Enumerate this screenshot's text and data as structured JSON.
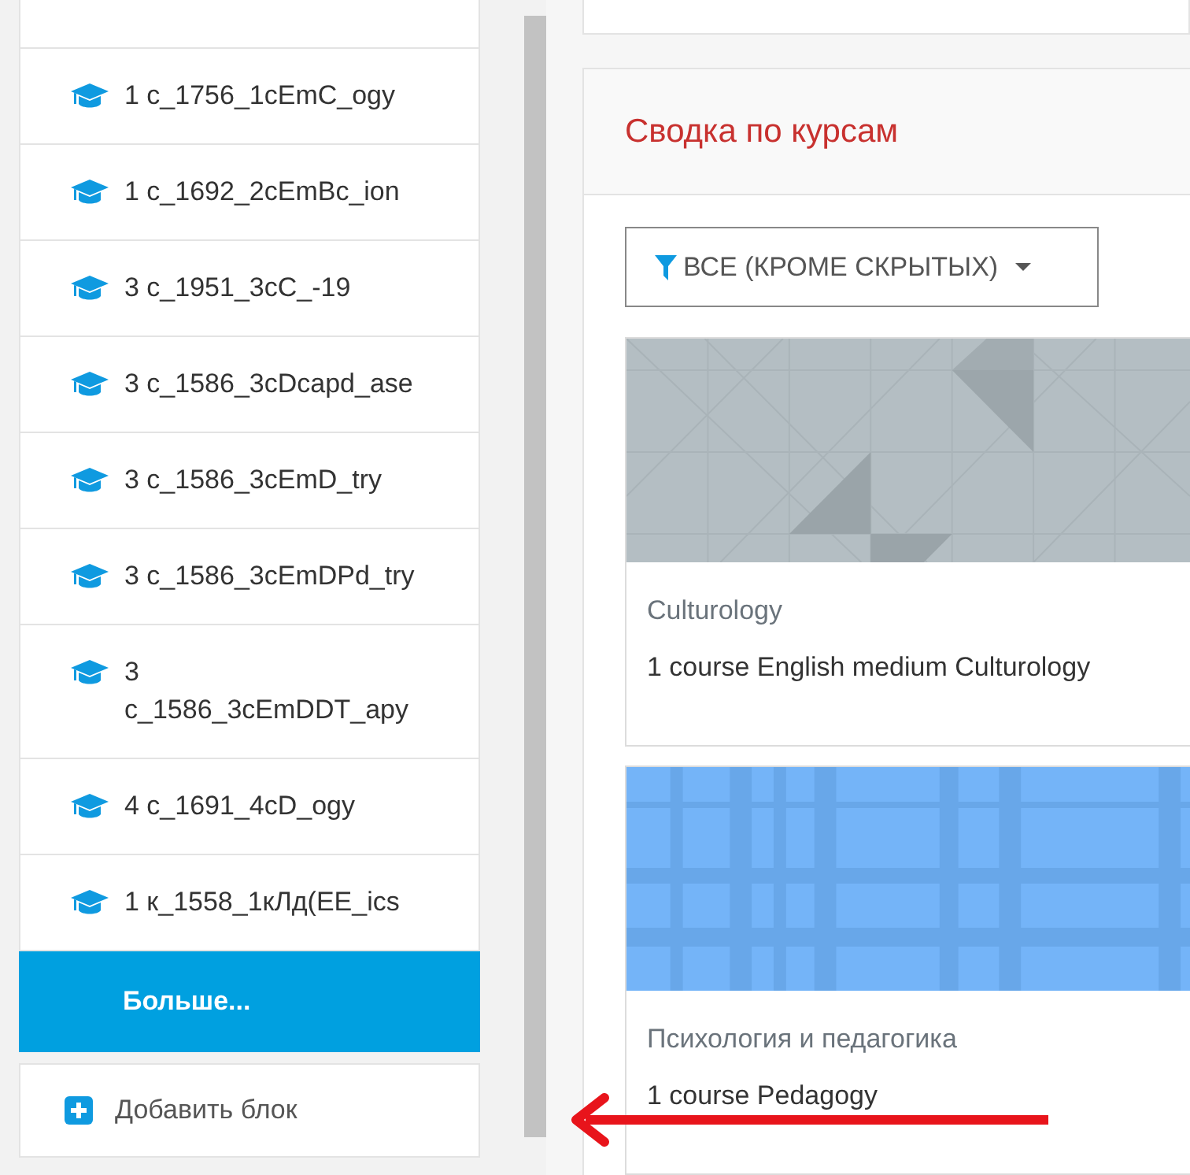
{
  "sidebar": {
    "items": [
      {
        "kind": "course",
        "label": "1 c_1756_1cEmC_ogy"
      },
      {
        "kind": "course",
        "label": "1 c_1692_2cEmBc_ion"
      },
      {
        "kind": "course",
        "label": "3 c_1951_3cC_-19"
      },
      {
        "kind": "course",
        "label": "3 c_1586_3cDcapd_ase"
      },
      {
        "kind": "course",
        "label": "3 c_1586_3cEmD_try"
      },
      {
        "kind": "course",
        "label": "3 c_1586_3cEmDPd_try"
      },
      {
        "kind": "course",
        "label": "3 c_1586_3cEmDDT_apy"
      },
      {
        "kind": "course",
        "label": "4 c_1691_4cD_ogy"
      },
      {
        "kind": "course",
        "label": "1 к_1558_1кЛд(EE_ics"
      },
      {
        "kind": "more",
        "label": "Больше..."
      }
    ],
    "add_block": "Добавить блок"
  },
  "main": {
    "title": "Сводка по курсам",
    "filter": "ВСЕ (КРОМЕ СКРЫТЫХ)",
    "courses": [
      {
        "kind": "triangles",
        "category": "Culturology",
        "name": "1 course English medium Culturology"
      },
      {
        "kind": "plaid",
        "category": "Психология и педагогика",
        "name": "1 course Pedagogy"
      }
    ]
  }
}
